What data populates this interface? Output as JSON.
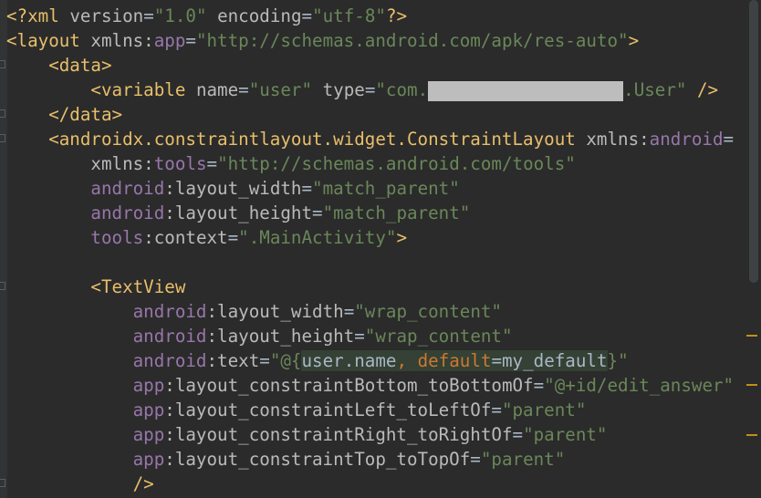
{
  "editor": {
    "lines": [
      [
        {
          "t": "<?xml ",
          "c": "tag"
        },
        {
          "t": "version",
          "c": "attr"
        },
        {
          "t": "=",
          "c": "plain"
        },
        {
          "t": "\"1.0\"",
          "c": "str"
        },
        {
          "t": " ",
          "c": "plain"
        },
        {
          "t": "encoding",
          "c": "attr"
        },
        {
          "t": "=",
          "c": "plain"
        },
        {
          "t": "\"utf-8\"",
          "c": "str"
        },
        {
          "t": "?>",
          "c": "tag"
        }
      ],
      [
        {
          "t": "<layout ",
          "c": "tag"
        },
        {
          "t": "xmlns:",
          "c": "attr"
        },
        {
          "t": "app",
          "c": "ns"
        },
        {
          "t": "=",
          "c": "plain"
        },
        {
          "t": "\"http://schemas.android.com/apk/res-auto\"",
          "c": "str"
        },
        {
          "t": ">",
          "c": "tag"
        }
      ],
      [
        {
          "t": "    <data>",
          "c": "tag"
        }
      ],
      [
        {
          "t": "        <variable ",
          "c": "tag"
        },
        {
          "t": "name",
          "c": "attr"
        },
        {
          "t": "=",
          "c": "plain"
        },
        {
          "t": "\"user\"",
          "c": "str"
        },
        {
          "t": " ",
          "c": "plain"
        },
        {
          "t": "type",
          "c": "attr"
        },
        {
          "t": "=",
          "c": "plain"
        },
        {
          "t": "\"com.",
          "c": "str"
        },
        {
          "t": "",
          "c": "redact"
        },
        {
          "t": ".User\"",
          "c": "str"
        },
        {
          "t": " />",
          "c": "tag"
        }
      ],
      [
        {
          "t": "    </data>",
          "c": "tag"
        }
      ],
      [
        {
          "t": "    <androidx.constraintlayout.widget.ConstraintLayout ",
          "c": "tag"
        },
        {
          "t": "xmlns:",
          "c": "attr"
        },
        {
          "t": "android",
          "c": "ns"
        },
        {
          "t": "=",
          "c": "plain"
        }
      ],
      [
        {
          "t": "        ",
          "c": "plain"
        },
        {
          "t": "xmlns:",
          "c": "attr"
        },
        {
          "t": "tools",
          "c": "ns"
        },
        {
          "t": "=",
          "c": "plain"
        },
        {
          "t": "\"http://schemas.android.com/tools\"",
          "c": "str"
        }
      ],
      [
        {
          "t": "        ",
          "c": "plain"
        },
        {
          "t": "android",
          "c": "ns"
        },
        {
          "t": ":layout_width",
          "c": "attr"
        },
        {
          "t": "=",
          "c": "plain"
        },
        {
          "t": "\"match_parent\"",
          "c": "str"
        }
      ],
      [
        {
          "t": "        ",
          "c": "plain"
        },
        {
          "t": "android",
          "c": "ns"
        },
        {
          "t": ":layout_height",
          "c": "attr"
        },
        {
          "t": "=",
          "c": "plain"
        },
        {
          "t": "\"match_parent\"",
          "c": "str"
        }
      ],
      [
        {
          "t": "        ",
          "c": "plain"
        },
        {
          "t": "tools",
          "c": "ns"
        },
        {
          "t": ":context",
          "c": "attr"
        },
        {
          "t": "=",
          "c": "plain"
        },
        {
          "t": "\".MainActivity\"",
          "c": "str"
        },
        {
          "t": ">",
          "c": "tag"
        }
      ],
      [
        {
          "t": "",
          "c": "plain"
        }
      ],
      [
        {
          "t": "        <TextView",
          "c": "tag"
        }
      ],
      [
        {
          "t": "            ",
          "c": "plain"
        },
        {
          "t": "android",
          "c": "ns"
        },
        {
          "t": ":layout_width",
          "c": "attr"
        },
        {
          "t": "=",
          "c": "plain"
        },
        {
          "t": "\"wrap_content\"",
          "c": "str"
        }
      ],
      [
        {
          "t": "            ",
          "c": "plain"
        },
        {
          "t": "android",
          "c": "ns"
        },
        {
          "t": ":layout_height",
          "c": "attr"
        },
        {
          "t": "=",
          "c": "plain"
        },
        {
          "t": "\"wrap_content\"",
          "c": "str"
        }
      ],
      [
        {
          "t": "            ",
          "c": "plain"
        },
        {
          "t": "android",
          "c": "ns"
        },
        {
          "t": ":text",
          "c": "attr"
        },
        {
          "t": "=",
          "c": "plain"
        },
        {
          "t": "\"@{",
          "c": "str"
        },
        {
          "t": "user.name",
          "c": "plain hl"
        },
        {
          "t": ", ",
          "c": "orange hl"
        },
        {
          "t": "default",
          "c": "orange hl"
        },
        {
          "t": "=my_default",
          "c": "plain hl"
        },
        {
          "t": "}\"",
          "c": "str"
        }
      ],
      [
        {
          "t": "            ",
          "c": "plain"
        },
        {
          "t": "app",
          "c": "ns"
        },
        {
          "t": ":layout_constraintBottom_toBottomOf",
          "c": "attr"
        },
        {
          "t": "=",
          "c": "plain"
        },
        {
          "t": "\"@+id/edit_answer\"",
          "c": "str"
        }
      ],
      [
        {
          "t": "            ",
          "c": "plain"
        },
        {
          "t": "app",
          "c": "ns"
        },
        {
          "t": ":layout_constraintLeft_toLeftOf",
          "c": "attr"
        },
        {
          "t": "=",
          "c": "plain"
        },
        {
          "t": "\"parent\"",
          "c": "str"
        }
      ],
      [
        {
          "t": "            ",
          "c": "plain"
        },
        {
          "t": "app",
          "c": "ns"
        },
        {
          "t": ":layout_constraintRight_toRightOf",
          "c": "attr"
        },
        {
          "t": "=",
          "c": "plain"
        },
        {
          "t": "\"parent\"",
          "c": "str"
        }
      ],
      [
        {
          "t": "            ",
          "c": "plain"
        },
        {
          "t": "app",
          "c": "ns"
        },
        {
          "t": ":layout_constraintTop_toTopOf",
          "c": "attr"
        },
        {
          "t": "=",
          "c": "plain"
        },
        {
          "t": "\"parent\"",
          "c": "str"
        }
      ],
      [
        {
          "t": "            />",
          "c": "tag"
        }
      ]
    ]
  },
  "colors": {
    "background": "#2b2b2b",
    "tag": "#e8bf6a",
    "namespace": "#9876aa",
    "attribute": "#bababa",
    "string": "#6a8759",
    "keyword": "#cc7832",
    "text": "#a9b7c6"
  }
}
